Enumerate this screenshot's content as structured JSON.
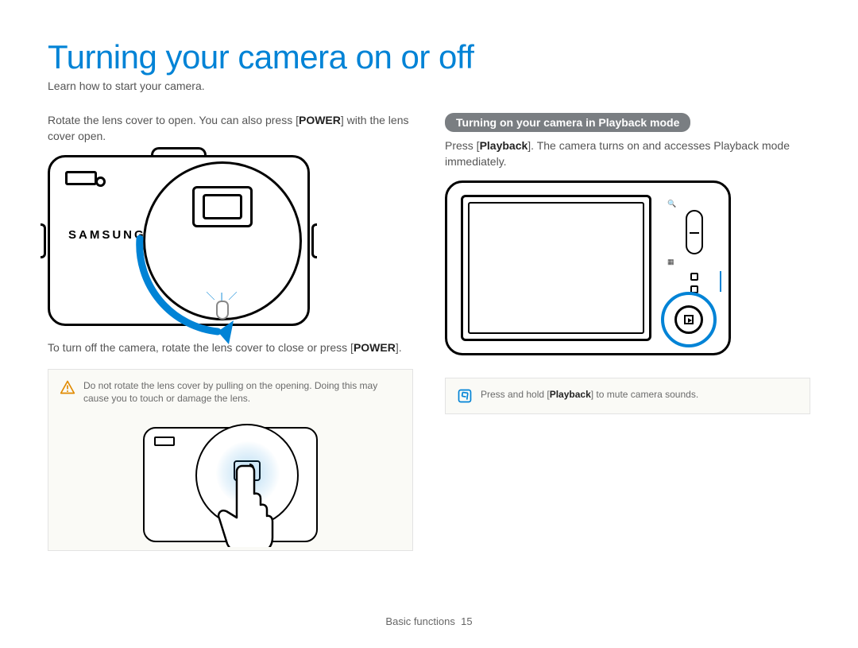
{
  "page": {
    "title": "Turning your camera on or off",
    "subtitle": "Learn how to start your camera."
  },
  "left": {
    "intro_pre": "Rotate the lens cover to open. You can also press [",
    "intro_bold": "POWER",
    "intro_post": "] with the lens cover open.",
    "brand": "SAMSUNG",
    "turnoff_pre": "To turn off the camera, rotate the lens cover to close or press [",
    "turnoff_bold": "POWER",
    "turnoff_post": "].",
    "caution_text": "Do not rotate the lens cover by pulling on the opening. Doing this may cause you to touch or damage the lens."
  },
  "right": {
    "heading": "Turning on your camera in Playback mode",
    "body_pre": "Press [",
    "body_bold": "Playback",
    "body_post": "]. The camera turns on and accesses Playback mode immediately.",
    "tip_pre": "Press and hold [",
    "tip_bold": "Playback",
    "tip_post": "] to mute camera sounds."
  },
  "footer": {
    "section": "Basic functions",
    "page_number": "15"
  }
}
